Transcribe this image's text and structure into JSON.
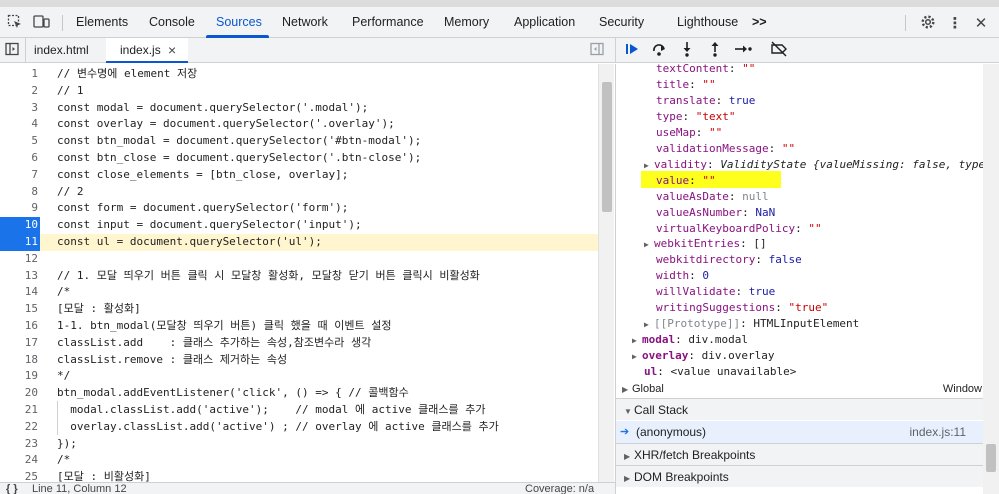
{
  "main_tabs": [
    "Elements",
    "Console",
    "Sources",
    "Network",
    "Performance",
    "Memory",
    "Application",
    "Security",
    "Lighthouse"
  ],
  "active_tab": "Sources",
  "more_tabs": ">>",
  "file_tabs": [
    "index.html",
    "index.js"
  ],
  "close_glyph": "×",
  "code_lines": [
    {
      "n": "1",
      "t": "// 변수명에 element 저장"
    },
    {
      "n": "2",
      "t": "// 1"
    },
    {
      "n": "3",
      "t": "const modal = document.querySelector('.modal');"
    },
    {
      "n": "4",
      "t": "const overlay = document.querySelector('.overlay');"
    },
    {
      "n": "5",
      "t": "const btn_modal = document.querySelector('#btn-modal');"
    },
    {
      "n": "6",
      "t": "const btn_close = document.querySelector('.btn-close');"
    },
    {
      "n": "7",
      "t": "const close_elements = [btn_close, overlay];"
    },
    {
      "n": "8",
      "t": "// 2"
    },
    {
      "n": "9",
      "t": "const form = document.querySelector('form');"
    },
    {
      "n": "10",
      "t": "const input = document.querySelector('input');"
    },
    {
      "n": "11",
      "t": "const ul = document.querySelector('ul');"
    },
    {
      "n": "12",
      "t": ""
    },
    {
      "n": "13",
      "t": "// 1. 모달 띄우기 버튼 클릭 시 모달창 활성화, 모달창 닫기 버튼 클릭시 비활성화"
    },
    {
      "n": "14",
      "t": "/*"
    },
    {
      "n": "15",
      "t": "[모달 : 활성화]"
    },
    {
      "n": "16",
      "t": "1-1. btn_modal(모달창 띄우기 버튼) 클릭 했을 때 이벤트 설정"
    },
    {
      "n": "17",
      "t": "classList.add    : 클래스 추가하는 속성,참조변수라 생각"
    },
    {
      "n": "18",
      "t": "classList.remove : 클래스 제거하는 속성"
    },
    {
      "n": "19",
      "t": "*/"
    },
    {
      "n": "20",
      "t": "btn_modal.addEventListener('click', () => { // 콜백함수"
    },
    {
      "n": "21",
      "t": "  modal.classList.add('active');    // modal 에 active 클래스를 추가"
    },
    {
      "n": "22",
      "t": "  overlay.classList.add('active') ; // overlay 에 active 클래스를 추가"
    },
    {
      "n": "23",
      "t": "});"
    },
    {
      "n": "24",
      "t": "/*"
    },
    {
      "n": "25",
      "t": "[모달 : 비활성화]"
    }
  ],
  "status": {
    "position": "Line 11, Column 12",
    "coverage": "Coverage: n/a"
  },
  "scope_props": [
    {
      "k": "textContent",
      "v": "\"\"",
      "c": "str"
    },
    {
      "k": "title",
      "v": "\"\"",
      "c": "str"
    },
    {
      "k": "translate",
      "v": "true",
      "c": "kw"
    },
    {
      "k": "type",
      "v": "\"text\"",
      "c": "str"
    },
    {
      "k": "useMap",
      "v": "\"\"",
      "c": "str"
    },
    {
      "k": "validationMessage",
      "v": "\"\"",
      "c": "str"
    },
    {
      "k": "validity",
      "v": "ValidityState {valueMissing: false, typeMisma",
      "c": "obj",
      "exp": true,
      "italic": true
    },
    {
      "k": "value",
      "v": "\"\"",
      "c": "str"
    },
    {
      "k": "valueAsDate",
      "v": "null",
      "c": "null"
    },
    {
      "k": "valueAsNumber",
      "v": "NaN",
      "c": "num"
    },
    {
      "k": "virtualKeyboardPolicy",
      "v": "\"\"",
      "c": "str"
    },
    {
      "k": "webkitEntries",
      "v": "[]",
      "c": "obj",
      "exp": true
    },
    {
      "k": "webkitdirectory",
      "v": "false",
      "c": "kw"
    },
    {
      "k": "width",
      "v": "0",
      "c": "num"
    },
    {
      "k": "willValidate",
      "v": "true",
      "c": "kw"
    },
    {
      "k": "writingSuggestions",
      "v": "\"true\"",
      "c": "str"
    },
    {
      "k": "[[Prototype]]",
      "v": "HTMLInputElement",
      "c": "obj",
      "exp": true,
      "gray": true
    }
  ],
  "scope_vars": [
    {
      "k": "modal",
      "v": "div.modal",
      "exp": true
    },
    {
      "k": "overlay",
      "v": "div.overlay",
      "exp": true
    },
    {
      "k": "ul",
      "v": "<value unavailable>",
      "exp": false
    }
  ],
  "global": {
    "label": "Global",
    "value": "Window"
  },
  "call_stack": {
    "title": "Call Stack",
    "frame": "(anonymous)",
    "location": "index.js:11"
  },
  "sections": [
    "XHR/fetch Breakpoints",
    "DOM Breakpoints"
  ]
}
